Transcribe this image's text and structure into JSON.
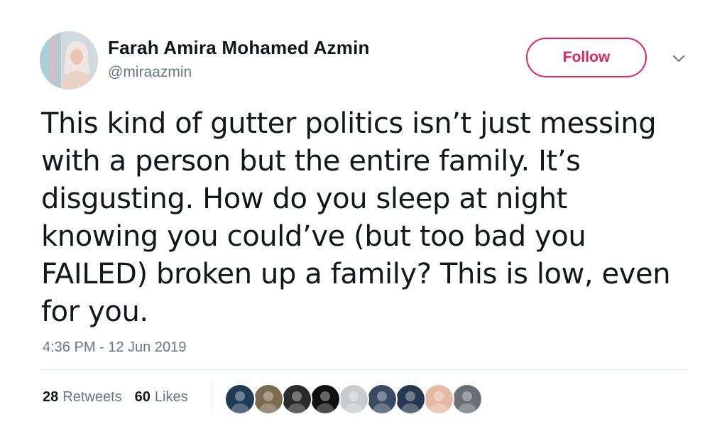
{
  "user": {
    "display_name": "Farah Amira Mohamed Azmin",
    "handle": "@miraazmin",
    "avatar_icon": "profile-photo"
  },
  "actions": {
    "follow_label": "Follow",
    "follow_color": "#e0245e",
    "more_icon": "chevron-down-icon"
  },
  "tweet": {
    "text": "This kind of gutter politics isn’t just messing with a person but the entire family. It’s disgusting. How do you sleep at night knowing you could’ve (but too bad you FAILED) broken up a family? This is low, even for you.",
    "timestamp": "4:36 PM - 12 Jun 2019"
  },
  "stats": {
    "retweets_count": "28",
    "retweets_label": "Retweets",
    "likes_count": "60",
    "likes_label": "Likes"
  },
  "likers": [
    {
      "icon": "liker-avatar",
      "color": "#1f3b57"
    },
    {
      "icon": "liker-avatar",
      "color": "#7a6a4f"
    },
    {
      "icon": "liker-avatar",
      "color": "#2b2b2b"
    },
    {
      "icon": "liker-avatar",
      "color": "#111111"
    },
    {
      "icon": "liker-avatar",
      "color": "#c9cbcd"
    },
    {
      "icon": "liker-avatar",
      "color": "#3a4a63"
    },
    {
      "icon": "liker-avatar",
      "color": "#26384f"
    },
    {
      "icon": "liker-avatar",
      "color": "#e6b9a4"
    },
    {
      "icon": "liker-avatar",
      "color": "#6b6f74"
    }
  ],
  "colors": {
    "text_primary": "#14171a",
    "text_secondary": "#657786",
    "divider": "#e1e8ed"
  }
}
